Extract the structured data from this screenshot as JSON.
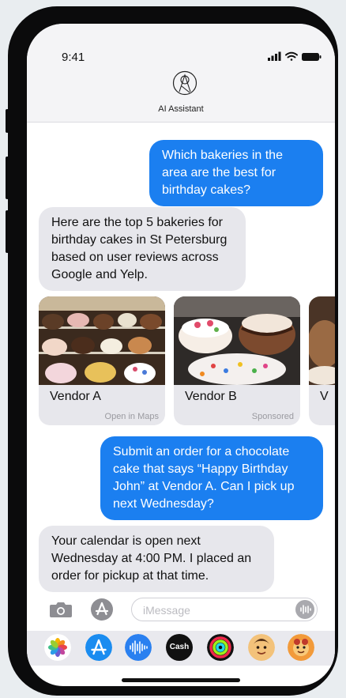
{
  "status_bar": {
    "time": "9:41"
  },
  "contact": {
    "name": "AI Assistant"
  },
  "messages": {
    "m1": "Which bakeries in the area are the best for birthday cakes?",
    "m2": "Here are the top 5 bakeries for birthday cakes in St Petersburg based on user reviews across Google and Yelp.",
    "m3": "Submit an order for a chocolate cake that says “Happy Birthday John” at Vendor A. Can I pick up next Wednesday?",
    "m4": "Your calendar is open next Wednesday at 4:00 PM. I placed an order for pickup at that time."
  },
  "vendors": [
    {
      "name": "Vendor A",
      "subtitle": "Open in Maps"
    },
    {
      "name": "Vendor B",
      "subtitle": "Sponsored"
    },
    {
      "name": "V",
      "subtitle": ""
    }
  ],
  "composer": {
    "placeholder": "iMessage"
  },
  "app_tray": {
    "cash_label": "Cash"
  },
  "colors": {
    "outgoing_bubble": "#1b7ff0",
    "incoming_bubble": "#e7e7ec"
  },
  "icons": [
    "camera-icon",
    "app-store-icon",
    "audio-input-icon",
    "photos-icon",
    "audio-messages-icon",
    "apple-cash-icon",
    "fitness-rings-icon",
    "memoji-icon",
    "sticker-icon"
  ]
}
